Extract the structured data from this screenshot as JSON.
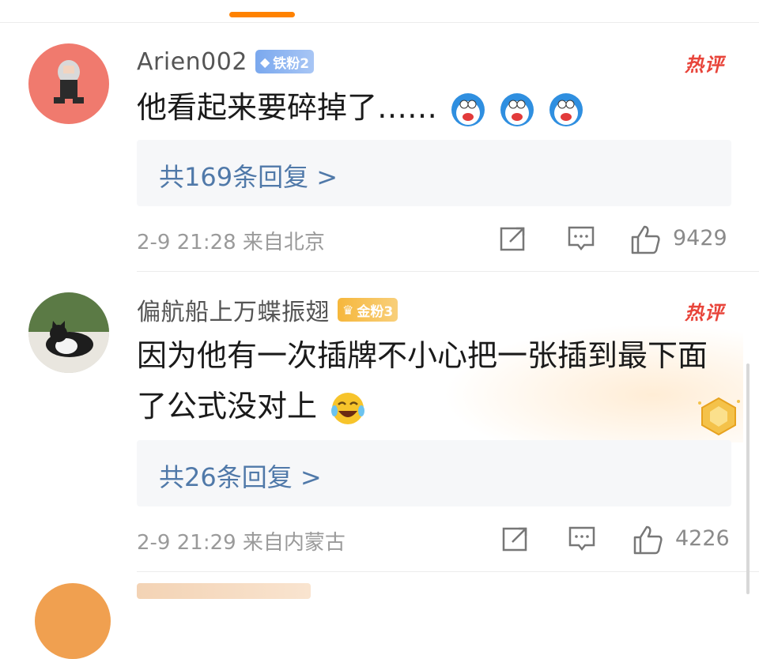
{
  "comments": [
    {
      "username": "Arien002",
      "badge": "铁粉2",
      "hot_tag": "热评",
      "text": "他看起来要碎掉了……",
      "replies_link": "共169条回复 >",
      "meta": "2-9 21:28 来自北京",
      "likes": "9429"
    },
    {
      "username": "偏航船上万蝶振翅",
      "badge": "金粉3",
      "hot_tag": "热评",
      "text": "因为他有一次插牌不小心把一张插到最下面了公式没对上",
      "replies_link": "共26条回复 >",
      "meta": "2-9 21:29 来自内蒙古",
      "likes": "4226"
    }
  ],
  "colors": {
    "accent": "#ff8200",
    "link": "#5079a9",
    "hot": "#e8443a",
    "badge_iron": "#7aa8ee",
    "badge_gold": "#f6b73c"
  },
  "icons": [
    "diamond-icon",
    "crown-icon",
    "doraemon-emoji",
    "laugh-cry-emoji",
    "share-icon",
    "comment-icon",
    "like-icon",
    "gold-fan-medal-icon"
  ]
}
